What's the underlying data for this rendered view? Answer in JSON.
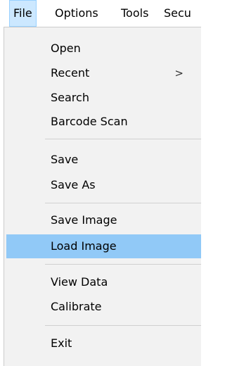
{
  "menubar": {
    "items": [
      {
        "label": "File"
      },
      {
        "label": "Options"
      },
      {
        "label": "Tools"
      },
      {
        "label": "Secu"
      }
    ]
  },
  "file_menu": {
    "items": [
      {
        "label": "Open"
      },
      {
        "label": "Recent",
        "submenu_arrow": ">"
      },
      {
        "label": "Search"
      },
      {
        "label": "Barcode Scan"
      },
      {
        "label": "Save"
      },
      {
        "label": "Save As"
      },
      {
        "label": "Save Image"
      },
      {
        "label": "Load Image",
        "highlighted": true
      },
      {
        "label": "View Data"
      },
      {
        "label": "Calibrate"
      },
      {
        "label": "Exit"
      }
    ]
  },
  "colors": {
    "menubar_active_bg": "#cce8ff",
    "dropdown_bg": "#f2f2f2",
    "highlight_bg": "#91c9f7",
    "separator": "#d0d0d0"
  }
}
